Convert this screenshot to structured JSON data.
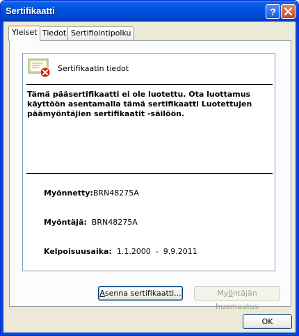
{
  "window": {
    "title": "Sertifikaatti",
    "help_label": "?"
  },
  "tabs": [
    {
      "label": "Yleiset",
      "active": true
    },
    {
      "label": "Tiedot",
      "active": false
    },
    {
      "label": "Sertifiointipolku",
      "active": false
    }
  ],
  "general": {
    "header_title": "Sertifikaatin tiedot",
    "description": "Tämä pääsertifikaatti ei ole luotettu. Ota luottamus käyttöön asentamalla tämä sertifikaatti Luotettujen päämyöntäjien sertifikaatit -säilöön.",
    "issued_to_label": "Myönnetty:",
    "issued_to_value": "BRN48275A",
    "issued_by_label": "Myöntäjä:",
    "issued_by_value": "BRN48275A",
    "validity_label": "Kelpoisuusaika:",
    "validity_value": "1.1.2000  -  9.9.2011",
    "install_button": {
      "mnemonic": "A",
      "rest": "senna sertifikaatti..."
    },
    "issuer_statement_button": {
      "pre": "My",
      "mnemonic": "ö",
      "rest": "ntäjän huomautus"
    }
  },
  "ok_button": "OK",
  "colors": {
    "titlebar": "#0052e0",
    "tab_highlight": "#ffc83c",
    "error_icon": "#d4200f",
    "window_bg": "#ece9d8"
  }
}
